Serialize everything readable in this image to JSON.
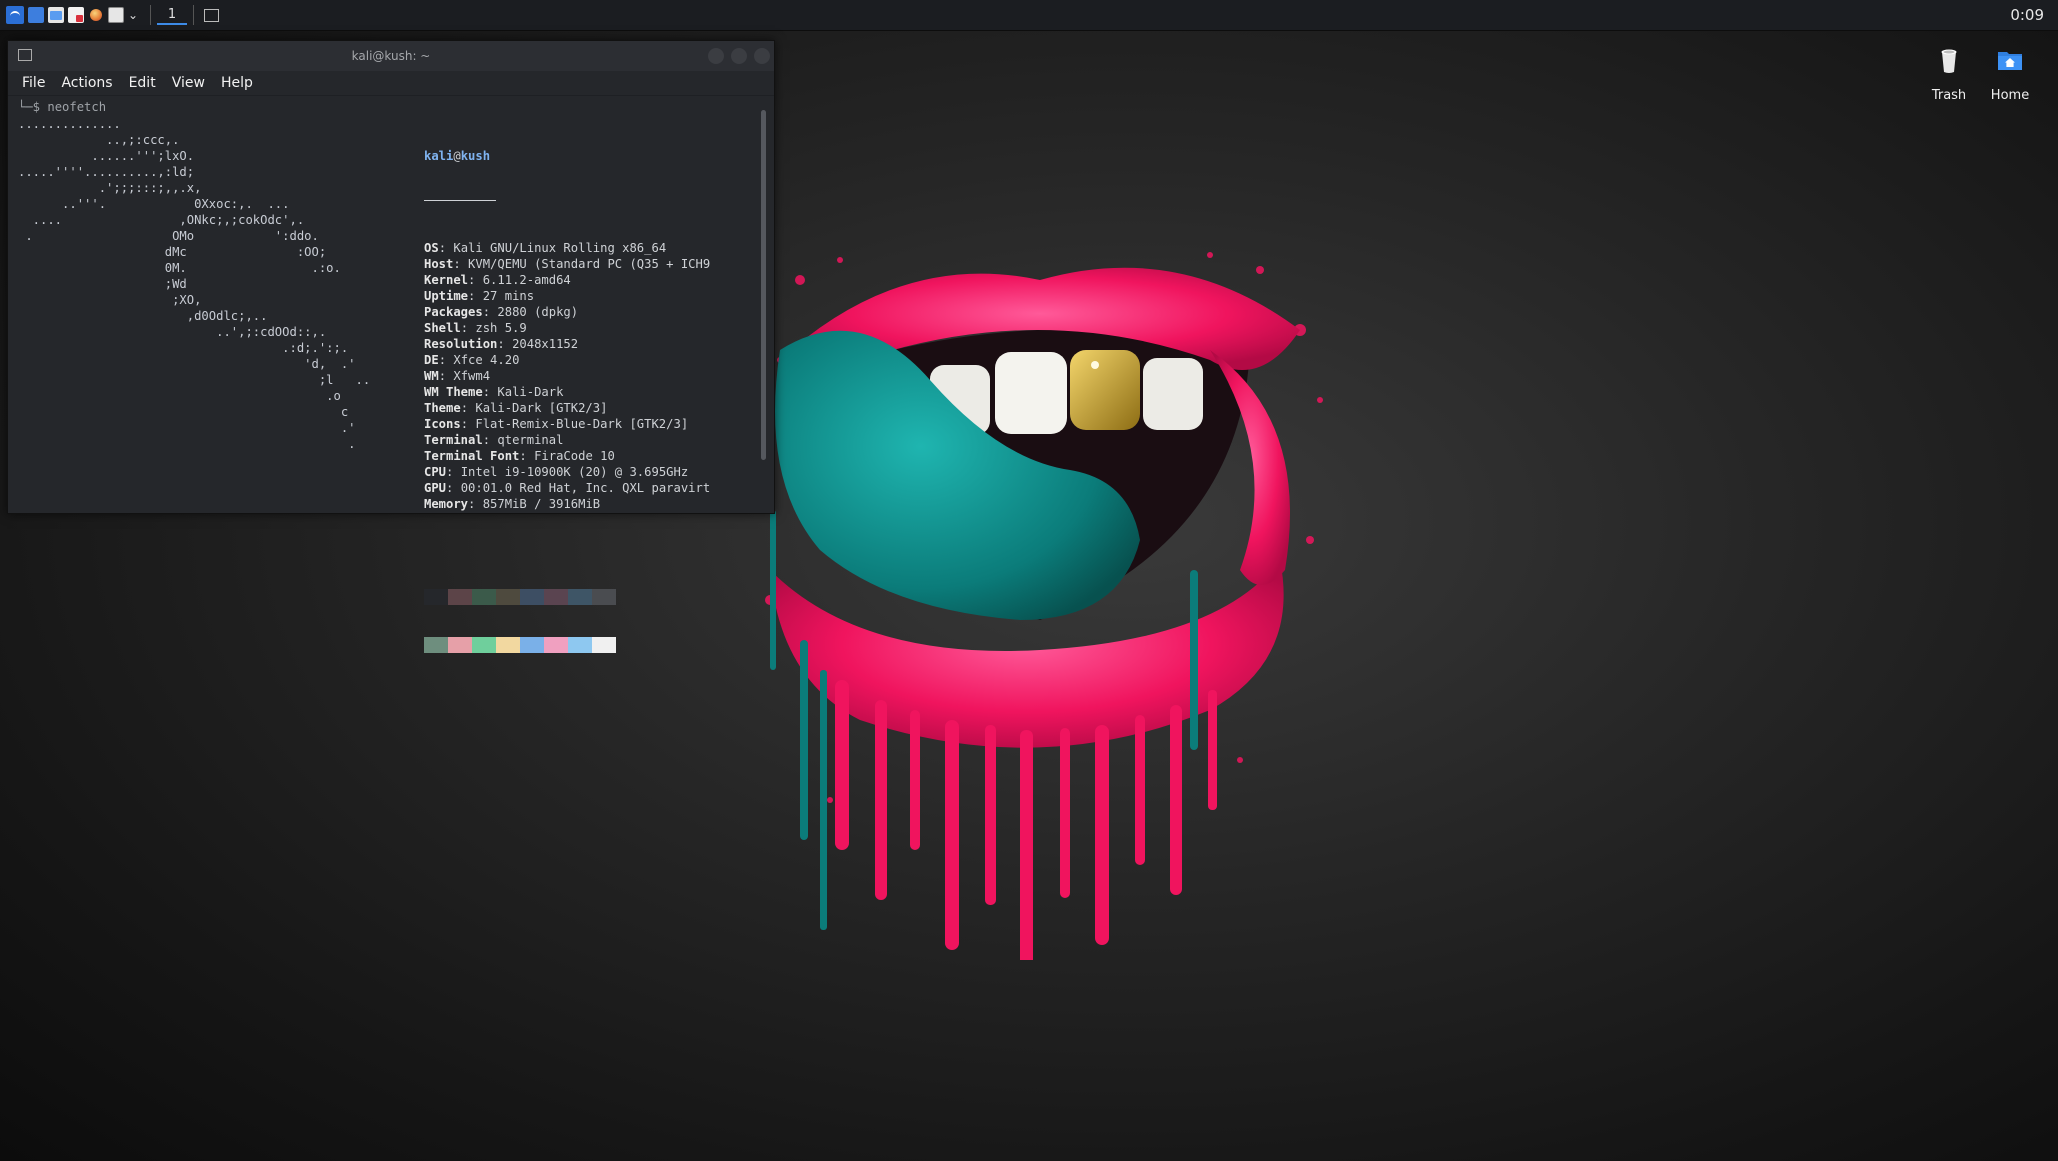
{
  "panel": {
    "workspace": "1",
    "clock": "0:09",
    "launchers": [
      "kali-menu-icon",
      "terminal-icon",
      "file-manager-icon",
      "text-editor-icon",
      "firefox-icon",
      "window-list-icon"
    ]
  },
  "desktop": {
    "icons": [
      {
        "label": "Trash",
        "icon": "trash-icon"
      },
      {
        "label": "Home",
        "icon": "home-folder-icon"
      }
    ]
  },
  "terminal": {
    "title": "kali@kush: ~",
    "menu": [
      "File",
      "Actions",
      "Edit",
      "View",
      "Help"
    ],
    "prompt_prefix": "└─$ ",
    "command": "neofetch",
    "ascii_logo": "..............\n            ..,;:ccc,.\n          ......''';lxO.\n.....''''..........,:ld;\n           .';;;:::;,,.x,\n      ..'''.            0Xxoc:,.  ...\n  ....                ,ONkc;,;cokOdc',.\n .                   OMo           ':ddo.\n                    dMc               :OO;\n                    0M.                 .:o.\n                    ;Wd\n                     ;XO,\n                       ,d0Odlc;,..\n                           ..',;:cdOOd::,.\n                                    .:d;.':;.\n                                       'd,  .'\n                                         ;l   ..\n                                          .o\n                                            c\n                                            .'\n                                             .",
    "user": "kali",
    "at": "@",
    "hostname": "kush",
    "info": [
      {
        "key": "OS",
        "value": "Kali GNU/Linux Rolling x86_64"
      },
      {
        "key": "Host",
        "value": "KVM/QEMU (Standard PC (Q35 + ICH9"
      },
      {
        "key": "Kernel",
        "value": "6.11.2-amd64"
      },
      {
        "key": "Uptime",
        "value": "27 mins"
      },
      {
        "key": "Packages",
        "value": "2880 (dpkg)"
      },
      {
        "key": "Shell",
        "value": "zsh 5.9"
      },
      {
        "key": "Resolution",
        "value": "2048x1152"
      },
      {
        "key": "DE",
        "value": "Xfce 4.20"
      },
      {
        "key": "WM",
        "value": "Xfwm4"
      },
      {
        "key": "WM Theme",
        "value": "Kali-Dark"
      },
      {
        "key": "Theme",
        "value": "Kali-Dark [GTK2/3]"
      },
      {
        "key": "Icons",
        "value": "Flat-Remix-Blue-Dark [GTK2/3]"
      },
      {
        "key": "Terminal",
        "value": "qterminal"
      },
      {
        "key": "Terminal Font",
        "value": "FiraCode 10"
      },
      {
        "key": "CPU",
        "value": "Intel i9-10900K (20) @ 3.695GHz"
      },
      {
        "key": "GPU",
        "value": "00:01.0 Red Hat, Inc. QXL paravirt"
      },
      {
        "key": "Memory",
        "value": "857MiB / 3916MiB"
      }
    ],
    "palette_top": [
      "#25272b",
      "#5c4448",
      "#3b5a4a",
      "#4e4a3e",
      "#3d4e63",
      "#5a4450",
      "#3e5566",
      "#4a4c50"
    ],
    "palette_bottom": [
      "#6e8e7e",
      "#e6a0a8",
      "#6fcf9c",
      "#f2d8a0",
      "#7ab0e8",
      "#f0a0c0",
      "#8ec8f0",
      "#f0f0f0"
    ]
  },
  "colors": {
    "accent": "#3d8be8",
    "lip_pink": "#ff1f6e",
    "tongue_teal": "#0d8b88",
    "gold_tooth": "#c9a52a"
  }
}
